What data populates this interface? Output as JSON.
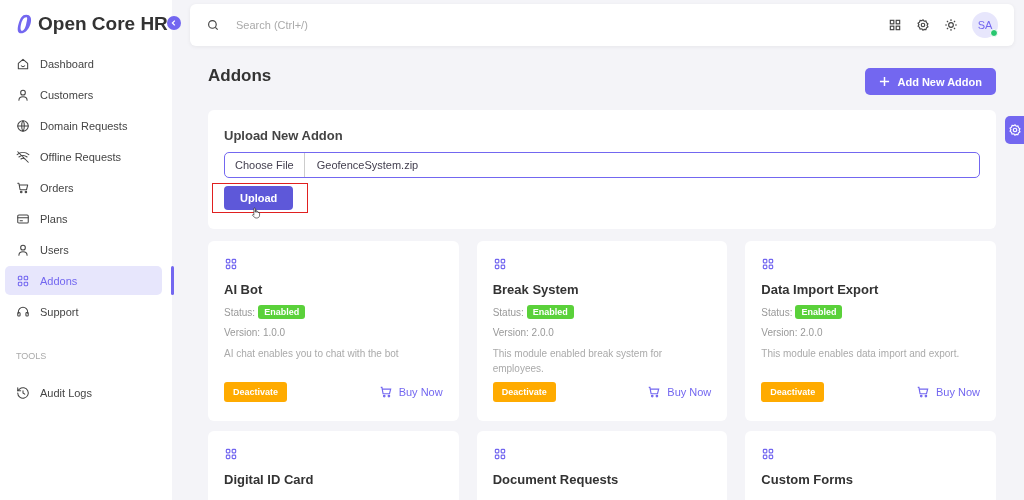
{
  "brand": {
    "name": "Open Core HR"
  },
  "sidebar": {
    "items": [
      {
        "label": "Dashboard",
        "selected": false
      },
      {
        "label": "Customers",
        "selected": false
      },
      {
        "label": "Domain Requests",
        "selected": false
      },
      {
        "label": "Offline Requests",
        "selected": false
      },
      {
        "label": "Orders",
        "selected": false
      },
      {
        "label": "Plans",
        "selected": false
      },
      {
        "label": "Users",
        "selected": false
      },
      {
        "label": "Addons",
        "selected": true
      },
      {
        "label": "Support",
        "selected": false
      }
    ],
    "section": "TOOLS",
    "tool_items": [
      {
        "label": "Audit Logs",
        "selected": false
      }
    ]
  },
  "topbar": {
    "search": {
      "placeholder": "Search (Ctrl+/)"
    },
    "avatar": {
      "initials": "SA",
      "online": true
    }
  },
  "page": {
    "title": "Addons",
    "add_button": "Add New Addon"
  },
  "upload": {
    "title": "Upload New Addon",
    "choose_button": "Choose File",
    "file_name": "GeofenceSystem.zip",
    "upload_button": "Upload",
    "highlighted": true
  },
  "addons": [
    {
      "name": "AI Bot",
      "status_label": "Status:",
      "status": "Enabled",
      "version": "Version: 1.0.0",
      "description": "AI chat enables you to chat with the bot",
      "action": "Deactivate",
      "buy": "Buy Now"
    },
    {
      "name": "Break System",
      "status_label": "Status:",
      "status": "Enabled",
      "version": "Version: 2.0.0",
      "description": "This module enabled break system for employees.",
      "action": "Deactivate",
      "buy": "Buy Now"
    },
    {
      "name": "Data Import Export",
      "status_label": "Status:",
      "status": "Enabled",
      "version": "Version: 2.0.0",
      "description": "This module enables data import and export.",
      "action": "Deactivate",
      "buy": "Buy Now"
    },
    {
      "name": "Digital ID Card"
    },
    {
      "name": "Document Requests"
    },
    {
      "name": "Custom Forms"
    }
  ]
}
